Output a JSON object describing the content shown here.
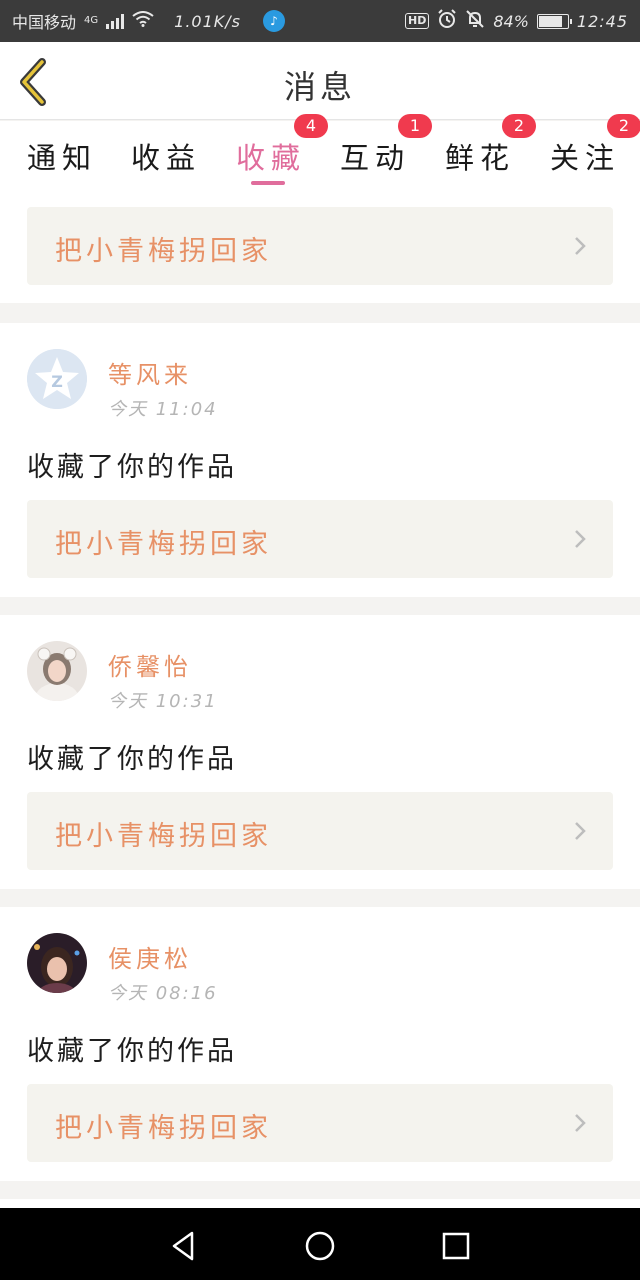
{
  "status_bar": {
    "carrier": "中国移动",
    "network": "4G",
    "speed": "1.01K/s",
    "battery": "84%",
    "battery_level": 0.84,
    "time": "12:45",
    "hd_label": "HD"
  },
  "header": {
    "title": "消息",
    "back_icon": "chevron-left-icon"
  },
  "tabs": [
    {
      "label": "通知",
      "badge": null,
      "active": false
    },
    {
      "label": "收益",
      "badge": null,
      "active": false
    },
    {
      "label": "收藏",
      "badge": "4",
      "active": true
    },
    {
      "label": "互动",
      "badge": "1",
      "active": false
    },
    {
      "label": "鲜花",
      "badge": "2",
      "active": false
    },
    {
      "label": "关注",
      "badge": "2",
      "active": false
    }
  ],
  "top_item": {
    "work_title": "把小青梅拐回家"
  },
  "messages": [
    {
      "user": "等风来",
      "time": "今天 11:04",
      "text": "收藏了你的作品",
      "work_title": "把小青梅拐回家",
      "avatar": "default-qzone-avatar"
    },
    {
      "user": "侨馨怡",
      "time": "今天 10:31",
      "text": "收藏了你的作品",
      "work_title": "把小青梅拐回家",
      "avatar": "girl-photo-avatar"
    },
    {
      "user": "侯庚松",
      "time": "今天 08:16",
      "text": "收藏了你的作品",
      "work_title": "把小青梅拐回家",
      "avatar": "girl-dark-photo-avatar"
    }
  ],
  "colors": {
    "accent_pink": "#e06d9c",
    "accent_orange": "#e79166",
    "badge_red": "#f03a4e"
  }
}
